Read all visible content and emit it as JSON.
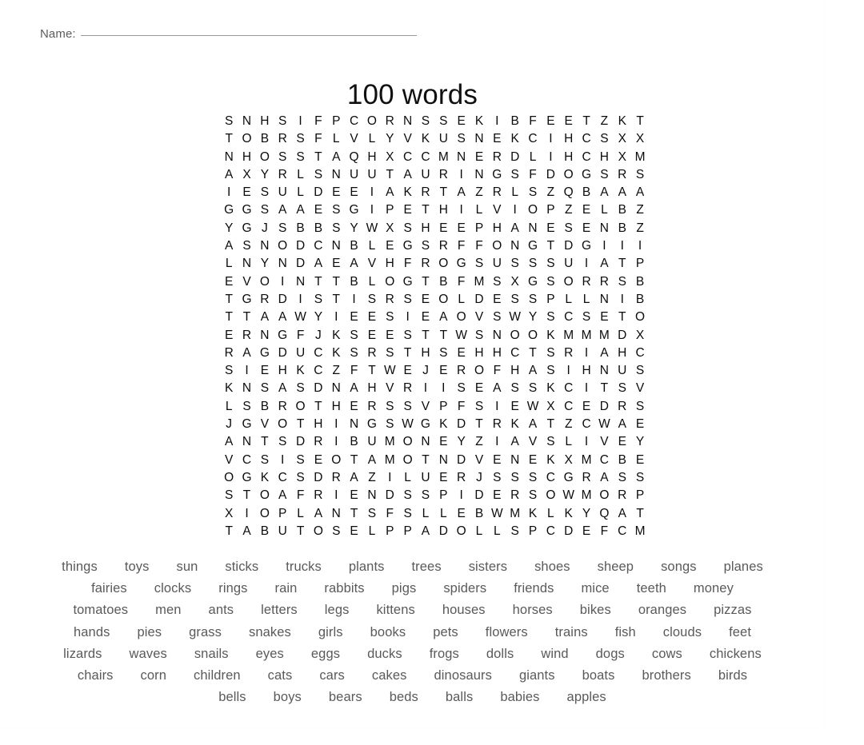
{
  "header": {
    "name_label": "Name:",
    "name_value": ""
  },
  "title": "100 words",
  "grid": {
    "columns": 24,
    "rows": 24,
    "letters": [
      [
        "S",
        "N",
        "H",
        "S",
        "I",
        "F",
        "P",
        "C",
        "O",
        "R",
        "N",
        "S",
        "S",
        "E",
        "K",
        "I",
        "B",
        "F",
        "E",
        "E",
        "T",
        "Z",
        "K",
        "T"
      ],
      [
        "T",
        "O",
        "B",
        "R",
        "S",
        "F",
        "L",
        "V",
        "L",
        "Y",
        "V",
        "K",
        "U",
        "S",
        "N",
        "E",
        "K",
        "C",
        "I",
        "H",
        "C",
        "S",
        "X",
        "X"
      ],
      [
        "N",
        "H",
        "O",
        "S",
        "S",
        "T",
        "A",
        "Q",
        "H",
        "X",
        "C",
        "C",
        "M",
        "N",
        "E",
        "R",
        "D",
        "L",
        "I",
        "H",
        "C",
        "H",
        "X",
        "M"
      ],
      [
        "A",
        "X",
        "Y",
        "R",
        "L",
        "S",
        "N",
        "U",
        "U",
        "T",
        "A",
        "U",
        "R",
        "I",
        "N",
        "G",
        "S",
        "F",
        "D",
        "O",
        "G",
        "S",
        "R",
        "S"
      ],
      [
        "I",
        "E",
        "S",
        "U",
        "L",
        "D",
        "E",
        "E",
        "I",
        "A",
        "K",
        "R",
        "T",
        "A",
        "Z",
        "R",
        "L",
        "S",
        "Z",
        "Q",
        "B",
        "A",
        "A",
        "A"
      ],
      [
        "G",
        "G",
        "S",
        "A",
        "A",
        "E",
        "S",
        "G",
        "I",
        "P",
        "E",
        "T",
        "H",
        "I",
        "L",
        "V",
        "I",
        "O",
        "P",
        "Z",
        "E",
        "L",
        "B",
        "Z"
      ],
      [
        "Y",
        "G",
        "J",
        "S",
        "B",
        "B",
        "S",
        "Y",
        "W",
        "X",
        "S",
        "H",
        "E",
        "E",
        "P",
        "H",
        "A",
        "N",
        "E",
        "S",
        "E",
        "N",
        "B",
        "Z"
      ],
      [
        "A",
        "S",
        "N",
        "O",
        "D",
        "C",
        "N",
        "B",
        "L",
        "E",
        "G",
        "S",
        "R",
        "F",
        "F",
        "O",
        "N",
        "G",
        "T",
        "D",
        "G",
        "I",
        "I",
        "I"
      ],
      [
        "L",
        "N",
        "Y",
        "N",
        "D",
        "A",
        "E",
        "A",
        "V",
        "H",
        "F",
        "R",
        "O",
        "G",
        "S",
        "U",
        "S",
        "S",
        "S",
        "U",
        "I",
        "A",
        "T",
        "P"
      ],
      [
        "E",
        "V",
        "O",
        "I",
        "N",
        "T",
        "T",
        "B",
        "L",
        "O",
        "G",
        "T",
        "B",
        "F",
        "M",
        "S",
        "X",
        "G",
        "S",
        "O",
        "R",
        "R",
        "S",
        "B"
      ],
      [
        "T",
        "G",
        "R",
        "D",
        "I",
        "S",
        "T",
        "I",
        "S",
        "R",
        "S",
        "E",
        "O",
        "L",
        "D",
        "E",
        "S",
        "S",
        "P",
        "L",
        "L",
        "N",
        "I",
        "B"
      ],
      [
        "T",
        "T",
        "A",
        "A",
        "W",
        "Y",
        "I",
        "E",
        "E",
        "S",
        "I",
        "E",
        "A",
        "O",
        "V",
        "S",
        "W",
        "Y",
        "S",
        "C",
        "S",
        "E",
        "T",
        "O"
      ],
      [
        "E",
        "R",
        "N",
        "G",
        "F",
        "J",
        "K",
        "S",
        "E",
        "E",
        "S",
        "T",
        "T",
        "W",
        "S",
        "N",
        "O",
        "O",
        "K",
        "M",
        "M",
        "M",
        "D",
        "X"
      ],
      [
        "R",
        "A",
        "G",
        "D",
        "U",
        "C",
        "K",
        "S",
        "R",
        "S",
        "T",
        "H",
        "S",
        "E",
        "H",
        "H",
        "C",
        "T",
        "S",
        "R",
        "I",
        "A",
        "H",
        "C"
      ],
      [
        "S",
        "I",
        "E",
        "H",
        "K",
        "C",
        "Z",
        "F",
        "T",
        "W",
        "E",
        "J",
        "E",
        "R",
        "O",
        "F",
        "H",
        "A",
        "S",
        "I",
        "H",
        "N",
        "U",
        "S"
      ],
      [
        "K",
        "N",
        "S",
        "A",
        "S",
        "D",
        "N",
        "A",
        "H",
        "V",
        "R",
        "I",
        "I",
        "S",
        "E",
        "A",
        "S",
        "S",
        "K",
        "C",
        "I",
        "T",
        "S",
        "V"
      ],
      [
        "L",
        "S",
        "B",
        "R",
        "O",
        "T",
        "H",
        "E",
        "R",
        "S",
        "S",
        "V",
        "P",
        "F",
        "S",
        "I",
        "E",
        "W",
        "X",
        "C",
        "E",
        "D",
        "R",
        "S"
      ],
      [
        "J",
        "G",
        "V",
        "O",
        "T",
        "H",
        "I",
        "N",
        "G",
        "S",
        "W",
        "G",
        "K",
        "D",
        "T",
        "R",
        "K",
        "A",
        "T",
        "Z",
        "C",
        "W",
        "A",
        "E"
      ],
      [
        "A",
        "N",
        "T",
        "S",
        "D",
        "R",
        "I",
        "B",
        "U",
        "M",
        "O",
        "N",
        "E",
        "Y",
        "Z",
        "I",
        "A",
        "V",
        "S",
        "L",
        "I",
        "V",
        "E",
        "Y"
      ],
      [
        "V",
        "C",
        "S",
        "I",
        "S",
        "E",
        "O",
        "T",
        "A",
        "M",
        "O",
        "T",
        "N",
        "D",
        "V",
        "E",
        "N",
        "E",
        "K",
        "X",
        "M",
        "C",
        "B",
        "E"
      ],
      [
        "O",
        "G",
        "K",
        "C",
        "S",
        "D",
        "R",
        "A",
        "Z",
        "I",
        "L",
        "U",
        "E",
        "R",
        "J",
        "S",
        "S",
        "S",
        "C",
        "G",
        "R",
        "A",
        "S",
        "S"
      ],
      [
        "S",
        "T",
        "O",
        "A",
        "F",
        "R",
        "I",
        "E",
        "N",
        "D",
        "S",
        "S",
        "P",
        "I",
        "D",
        "E",
        "R",
        "S",
        "O",
        "W",
        "M",
        "O",
        "R",
        "P"
      ],
      [
        "X",
        "I",
        "O",
        "P",
        "L",
        "A",
        "N",
        "T",
        "S",
        "F",
        "S",
        "L",
        "L",
        "E",
        "B",
        "W",
        "M",
        "K",
        "L",
        "K",
        "Y",
        "Q",
        "A",
        "T"
      ],
      [
        "T",
        "A",
        "B",
        "U",
        "T",
        "O",
        "S",
        "E",
        "L",
        "P",
        "P",
        "A",
        "D",
        "O",
        "L",
        "L",
        "S",
        "P",
        "C",
        "D",
        "E",
        "F",
        "C",
        "M"
      ]
    ]
  },
  "word_list": {
    "rows": [
      [
        "things",
        "toys",
        "sun",
        "sticks",
        "trucks",
        "plants",
        "trees",
        "sisters",
        "shoes",
        "sheep",
        "songs",
        "planes"
      ],
      [
        "fairies",
        "clocks",
        "rings",
        "rain",
        "rabbits",
        "pigs",
        "spiders",
        "friends",
        "mice",
        "teeth",
        "money"
      ],
      [
        "tomatoes",
        "men",
        "ants",
        "letters",
        "legs",
        "kittens",
        "houses",
        "horses",
        "bikes",
        "oranges",
        "pizzas"
      ],
      [
        "hands",
        "pies",
        "grass",
        "snakes",
        "girls",
        "books",
        "pets",
        "flowers",
        "trains",
        "fish",
        "clouds",
        "feet"
      ],
      [
        "lizards",
        "waves",
        "snails",
        "eyes",
        "eggs",
        "ducks",
        "frogs",
        "dolls",
        "wind",
        "dogs",
        "cows",
        "chickens"
      ],
      [
        "chairs",
        "corn",
        "children",
        "cats",
        "cars",
        "cakes",
        "dinosaurs",
        "giants",
        "boats",
        "brothers",
        "birds"
      ],
      [
        "bells",
        "boys",
        "bears",
        "beds",
        "balls",
        "babies",
        "apples"
      ]
    ]
  },
  "colors": {
    "page_background": "#ffffff",
    "grid_letter": "#0c0c0c",
    "word_text": "#5a5a5a",
    "name_label": "#5d5d5d",
    "name_rule": "#9a9a9a",
    "title": "#101010"
  }
}
